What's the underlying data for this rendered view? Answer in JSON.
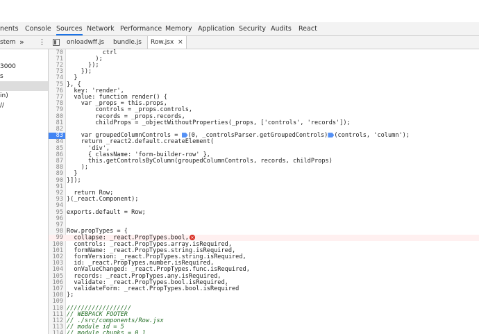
{
  "panel_tabs": [
    "nents",
    "Console",
    "Sources",
    "Network",
    "Performance",
    "Memory",
    "Application",
    "Security",
    "Audits",
    "React"
  ],
  "active_panel": "Sources",
  "subbar": {
    "left_label": "stem",
    "more": "»",
    "kebab": "⋮",
    "tabs": [
      "onloadwff.js",
      "bundle.js",
      "Row.jsx"
    ],
    "active_tab": "Row.jsx",
    "close": "×"
  },
  "sidebar": {
    "items": [
      "3000",
      "s",
      "",
      "in)",
      "//"
    ]
  },
  "code": {
    "breakpoint_line": "83",
    "error_line": "99",
    "lines": [
      {
        "n": "70",
        "t": "          ctrl"
      },
      {
        "n": "71",
        "t": "        );"
      },
      {
        "n": "72",
        "t": "      });"
      },
      {
        "n": "73",
        "t": "    });"
      },
      {
        "n": "74",
        "t": "  }"
      },
      {
        "n": "75",
        "t": "}, {"
      },
      {
        "n": "76",
        "t": "  key: 'render',"
      },
      {
        "n": "77",
        "t": "  value: function render() {"
      },
      {
        "n": "78",
        "t": "    var _props = this.props,"
      },
      {
        "n": "79",
        "t": "        controls = _props.controls,"
      },
      {
        "n": "80",
        "t": "        records = _props.records,"
      },
      {
        "n": "81",
        "t": "        childProps = _objectWithoutProperties(_props, ['controls', 'records']);"
      },
      {
        "n": "82",
        "t": ""
      },
      {
        "n": "83",
        "t": "    var groupedColumnControls = ",
        "t2": "(0, _controlsParser.getGroupedControls)",
        "t3": "(controls, 'column');"
      },
      {
        "n": "84",
        "t": "    return _react2.default.createElement("
      },
      {
        "n": "85",
        "t": "      'div',"
      },
      {
        "n": "86",
        "t": "      { className: 'form-builder-row' },"
      },
      {
        "n": "87",
        "t": "      this.getControlsByColumn(groupedColumnControls, records, childProps)"
      },
      {
        "n": "88",
        "t": "    );"
      },
      {
        "n": "89",
        "t": "  }"
      },
      {
        "n": "90",
        "t": "}]);"
      },
      {
        "n": "91",
        "t": ""
      },
      {
        "n": "92",
        "t": "  return Row;"
      },
      {
        "n": "93",
        "t": "}(_react.Component);"
      },
      {
        "n": "94",
        "t": ""
      },
      {
        "n": "95",
        "t": "exports.default = Row;"
      },
      {
        "n": "96",
        "t": ""
      },
      {
        "n": "97",
        "t": ""
      },
      {
        "n": "98",
        "t": "Row.propTypes = {"
      },
      {
        "n": "99",
        "t": "  collapse: _react.PropTypes.bool,"
      },
      {
        "n": "100",
        "t": "  controls: _react.PropTypes.array.isRequired,"
      },
      {
        "n": "101",
        "t": "  formName: _react.PropTypes.string.isRequired,"
      },
      {
        "n": "102",
        "t": "  formVersion: _react.PropTypes.string.isRequired,"
      },
      {
        "n": "103",
        "t": "  id: _react.PropTypes.number.isRequired,"
      },
      {
        "n": "104",
        "t": "  onValueChanged: _react.PropTypes.func.isRequired,"
      },
      {
        "n": "105",
        "t": "  records: _react.PropTypes.any.isRequired,"
      },
      {
        "n": "106",
        "t": "  validate: _react.PropTypes.bool.isRequired,"
      },
      {
        "n": "107",
        "t": "  validateForm: _react.PropTypes.bool.isRequired"
      },
      {
        "n": "108",
        "t": "};"
      },
      {
        "n": "109",
        "t": ""
      },
      {
        "n": "110",
        "t": "//////////////////"
      },
      {
        "n": "111",
        "t": "// WEBPACK FOOTER"
      },
      {
        "n": "112",
        "t": "// ./src/components/Row.jsx"
      },
      {
        "n": "113",
        "t": "// module id = 5"
      },
      {
        "n": "114",
        "t": "// module chunks = 0 1"
      }
    ]
  },
  "colors": {
    "accent": "#1a73e8",
    "breakpoint": "#4285f4",
    "error": "#d93025"
  }
}
